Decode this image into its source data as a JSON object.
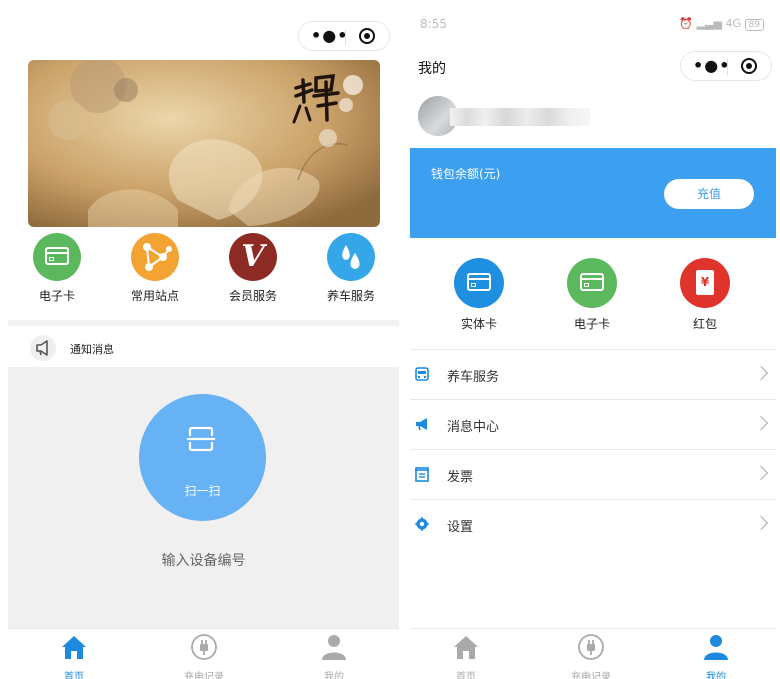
{
  "left": {
    "quick_items": [
      {
        "label": "电子卡",
        "icon": "e-card-icon",
        "color": "#5cb85c"
      },
      {
        "label": "常用站点",
        "icon": "station-network-icon",
        "color": "#f2a332"
      },
      {
        "label": "会员服务",
        "icon": "vip-v-icon",
        "color": "#8e2a24"
      },
      {
        "label": "养车服务",
        "icon": "water-drop-icon",
        "color": "#35a6e8"
      }
    ],
    "notice_label": "通知消息",
    "scan_label": "扫一扫",
    "device_input_label": "输入设备编号",
    "tabs": [
      {
        "label": "首页",
        "icon": "home-icon",
        "active": true
      },
      {
        "label": "充电记录",
        "icon": "charge-plug-icon",
        "active": false
      },
      {
        "label": "我的",
        "icon": "person-icon",
        "active": false
      }
    ]
  },
  "right": {
    "status_time": "8:55",
    "status_network": "4G",
    "status_battery": "89",
    "title": "我的",
    "wallet_label": "钱包余额(元)",
    "recharge_label": "充值",
    "cards": [
      {
        "label": "实体卡",
        "icon": "physical-card-icon",
        "color": "#1f8fe0"
      },
      {
        "label": "电子卡",
        "icon": "e-card-icon",
        "color": "#5cb85c"
      },
      {
        "label": "红包",
        "icon": "red-packet-icon",
        "color": "#e0332b"
      }
    ],
    "menu": [
      {
        "label": "养车服务",
        "icon": "car-service-icon"
      },
      {
        "label": "消息中心",
        "icon": "megaphone-icon"
      },
      {
        "label": "发票",
        "icon": "invoice-icon"
      },
      {
        "label": "设置",
        "icon": "settings-gear-icon"
      }
    ],
    "tabs": [
      {
        "label": "首页",
        "icon": "home-icon",
        "active": false
      },
      {
        "label": "充电记录",
        "icon": "charge-plug-icon",
        "active": false
      },
      {
        "label": "我的",
        "icon": "person-icon",
        "active": true
      }
    ]
  },
  "colors": {
    "accent": "#1d8ae0",
    "wallet_bg": "#3d9ff0",
    "scan_button": "#67b1f5",
    "inactive_tab": "#aaaaaa"
  }
}
